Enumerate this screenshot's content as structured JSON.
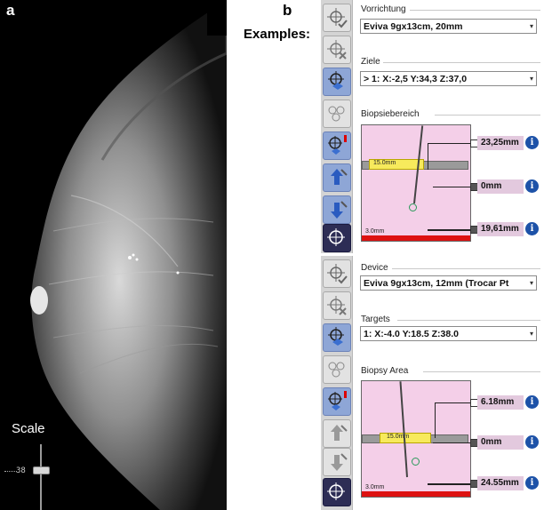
{
  "figure": {
    "label_a": "a",
    "label_b": "b",
    "examples_label": "Examples:"
  },
  "scale": {
    "label": "Scale",
    "value": "38"
  },
  "panel_de": {
    "device_label": "Vorrichtung",
    "device_value": "Eviva 9gx13cm, 20mm",
    "targets_label": "Ziele",
    "targets_value": "> 1: X:-2,5  Y:34,3  Z:37,0",
    "area_label": "Biopsiebereich",
    "yellow_text": "15.0mm",
    "bottom_text": "3.0mm",
    "readouts": [
      "23,25mm",
      "0mm",
      "19,61mm"
    ]
  },
  "panel_en": {
    "device_label": "Device",
    "device_value": "Eviva 9gx13cm, 12mm (Trocar Pt",
    "targets_label": "Targets",
    "targets_value": "1: X:-4.0  Y:18.5  Z:38.0",
    "area_label": "Biopsy Area",
    "yellow_text": "15.0mm",
    "bottom_text": "3.0mm",
    "readouts": [
      "6.18mm",
      "0mm",
      "24.55mm"
    ]
  },
  "icons": {
    "info": "i",
    "dropdown_arrow": "▾"
  },
  "colors": {
    "accent_blue": "#1d52a8",
    "biopsy_pink": "#f4cfe8",
    "readout_pink": "#e3c9de",
    "alert_red": "#dd1111",
    "needle_yellow": "#f7ea5c"
  }
}
